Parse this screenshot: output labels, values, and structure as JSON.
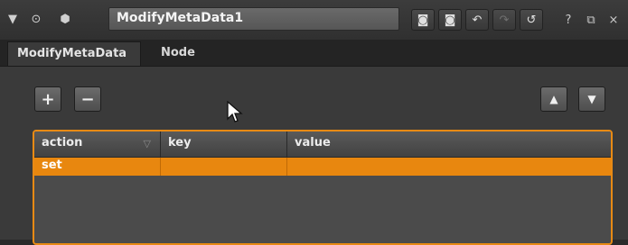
{
  "titlebar": {
    "node_name": "ModifyMetaData1",
    "icons": [
      "collapse-triangle-icon",
      "center-node-icon",
      "node-color-icon",
      "presets-icon",
      "reset-icon",
      "undo-icon",
      "redo-icon",
      "revert-icon",
      "help-icon",
      "float-icon",
      "close-icon"
    ],
    "help_glyph": "?",
    "close_glyph": "×"
  },
  "tabs": [
    {
      "label": "ModifyMetaData",
      "active": true
    },
    {
      "label": "Node",
      "active": false
    }
  ],
  "toolbar": {
    "add_label": "+",
    "remove_label": "−"
  },
  "table": {
    "columns": [
      "action",
      "key",
      "value"
    ],
    "rows": [
      {
        "action": "set",
        "key": "",
        "value": "",
        "selected": true
      }
    ]
  },
  "colors": {
    "accent": "#e8870f",
    "panel": "#3a3a3a"
  }
}
